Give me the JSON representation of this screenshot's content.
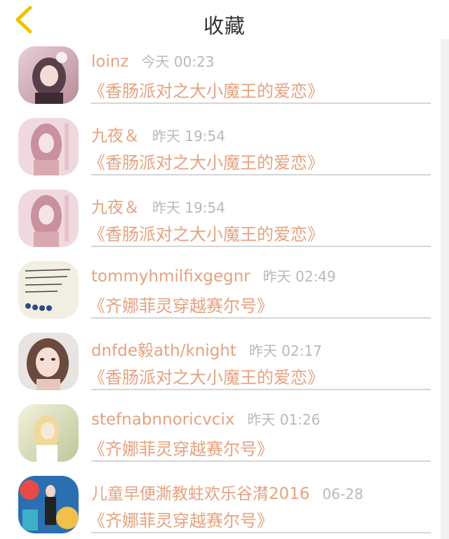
{
  "header": {
    "title": "收藏",
    "back_icon": "chevron-left-icon",
    "accent": "#f0c200"
  },
  "colors": {
    "name": "#e5a27f",
    "time": "#b9b9b9",
    "work": "#e5a27f",
    "separator": "#d6d6d6"
  },
  "favorites": [
    {
      "user": "loinz",
      "time": "今天 00:23",
      "work": "《香肠派对之大小魔王的爱恋》"
    },
    {
      "user": "九夜＆",
      "time": "昨天 19:54",
      "work": "《香肠派对之大小魔王的爱恋》"
    },
    {
      "user": "九夜＆",
      "time": "昨天 19:54",
      "work": "《香肠派对之大小魔王的爱恋》"
    },
    {
      "user": "tommyhmilfixgegnr",
      "time": "昨天 02:49",
      "work": "《齐娜菲灵穿越赛尔号》"
    },
    {
      "user": "dnfde毅ath/knight",
      "time": "昨天 02:17",
      "work": "《香肠派对之大小魔王的爱恋》"
    },
    {
      "user": "stefnabnnoricvcix",
      "time": "昨天 01:26",
      "work": "《齐娜菲灵穿越赛尔号》"
    },
    {
      "user": "儿童早便澌教蛀欢乐谷潸2016",
      "time": "06-28",
      "work": "《齐娜菲灵穿越赛尔号》"
    }
  ]
}
